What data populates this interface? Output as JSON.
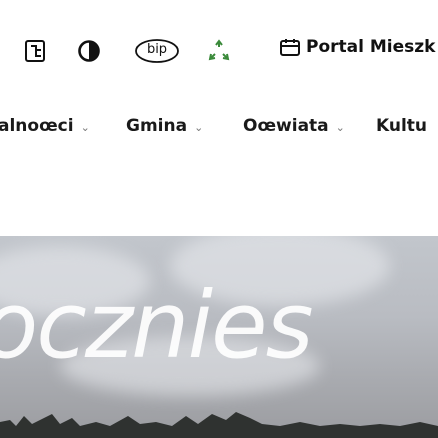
{
  "header": {
    "tools": [
      {
        "icon": "sitemap-icon"
      },
      {
        "icon": "contrast-icon"
      },
      {
        "icon": "bip-icon",
        "label": "bip"
      },
      {
        "icon": "recycle-icon"
      }
    ],
    "portal": {
      "icon": "calendar-icon",
      "label": "Portal Mieszk"
    }
  },
  "nav": {
    "items": [
      {
        "label": "alnoœci",
        "has_dropdown": true
      },
      {
        "label": "Gmina",
        "has_dropdown": true
      },
      {
        "label": "Oœwiata",
        "has_dropdown": true
      },
      {
        "label": "Kultu",
        "has_dropdown": false
      }
    ]
  },
  "hero": {
    "title": "ocznies"
  },
  "colors": {
    "accent_green": "#3a8a3a",
    "text": "#1a1a1a"
  }
}
